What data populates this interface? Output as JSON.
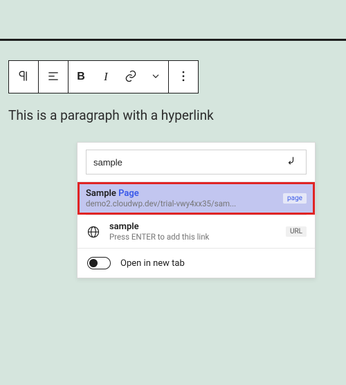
{
  "toolbar": {
    "block_icon": "pilcrow",
    "align_icon": "align-left",
    "bold_label": "B",
    "italic_label": "I",
    "link_icon": "link",
    "dropdown_icon": "chevron-down",
    "more_icon": "more-vertical"
  },
  "paragraph": {
    "text": "This is a paragraph with a hyperlink"
  },
  "link_popover": {
    "search_value": "sample",
    "submit_icon": "enter-arrow",
    "results": [
      {
        "title_plain": "Sample",
        "title_accent": "Page",
        "subtitle": "demo2.cloudwp.dev/trial-vwy4xx35/sam...",
        "badge": "page",
        "highlighted": true
      },
      {
        "title_plain": "sample",
        "title_accent": "",
        "subtitle": "Press ENTER to add this link",
        "badge": "URL",
        "highlighted": false
      }
    ],
    "open_new_tab_label": "Open in new tab",
    "open_new_tab_value": false
  }
}
